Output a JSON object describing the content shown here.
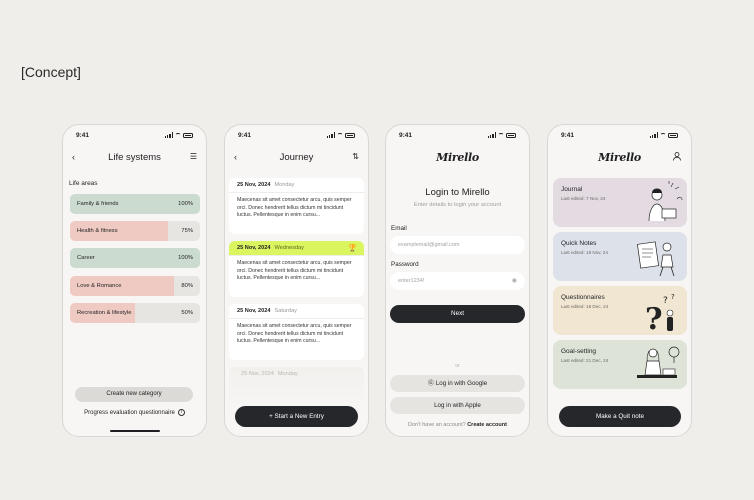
{
  "page_label": "[Concept]",
  "status_time": "9:41",
  "colors": {
    "green": "#ccdbcf",
    "pink": "#efcac2",
    "lime": "#d9f560",
    "lavender": "#e3dae2",
    "blue": "#dde1ea",
    "beige": "#f0e6d2",
    "sage": "#dde3d6"
  },
  "life": {
    "title": "Life systems",
    "back_icon": "chevron-left-icon",
    "filter_icon": "sliders-icon",
    "areas_label": "Life areas",
    "areas": [
      {
        "name": "Family & friends",
        "percent": "100%",
        "value": 100,
        "color": "#ccdbcf"
      },
      {
        "name": "Health & fitness",
        "percent": "75%",
        "value": 75,
        "color": "#efcac2"
      },
      {
        "name": "Career",
        "percent": "100%",
        "value": 100,
        "color": "#ccdbcf"
      },
      {
        "name": "Love & Romance",
        "percent": "80%",
        "value": 80,
        "color": "#efcac2"
      },
      {
        "name": "Recreation & lifestyle",
        "percent": "50%",
        "value": 50,
        "color": "#efcac2"
      }
    ],
    "create_btn": "Create new category",
    "questionnaire_link": "Progress evaluation questionnaire"
  },
  "journey": {
    "title": "Journey",
    "entries": [
      {
        "date": "25 Nov, 2024",
        "day": "Monday",
        "text": "Maecenas sit amet consectetur arcu, quis semper orci. Donec hendrerit tellus dictum mi tincidunt luctus. Pellentesque in enim cursu..."
      },
      {
        "date": "25 Nov, 2024",
        "day": "Wednesday",
        "text": "Maecenas sit amet consectetur arcu, quis semper orci. Donec hendrerit tellus dictum mi tincidunt luctus. Pellentesque in enim cursu..."
      },
      {
        "date": "25 Nov, 2024",
        "day": "Saturday",
        "text": "Maecenas sit amet consectetur arcu, quis semper orci. Donec hendrerit tellus dictum mi tincidunt luctus. Pellentesque in enim cursu..."
      }
    ],
    "faded_entry": {
      "date": "25 Nov, 2024",
      "day": "Monday"
    },
    "new_entry_btn": "Start a New Entry"
  },
  "login": {
    "logo": "Mirello",
    "title": "Login to Mirello",
    "subtitle": "Enter details to login your account",
    "email_label": "Email",
    "email_placeholder": "examplemail@gmail.com",
    "password_label": "Password",
    "password_value": "enter1234!",
    "next_btn": "Next",
    "or": "or",
    "google_btn": "Log in with Google",
    "apple_btn": "Log in with Apple",
    "no_account": "Don't have an account?",
    "create_account": "Create account"
  },
  "home": {
    "logo": "Mirello",
    "cards": [
      {
        "title": "Journal",
        "edited": "Last edited: 7 Nov, 24",
        "color": "#e3dae2"
      },
      {
        "title": "Quick Notes",
        "edited": "Last edited: 19 Nov, 24",
        "color": "#dde1ea"
      },
      {
        "title": "Questionnaires",
        "edited": "Last edited: 18 Dec, 24",
        "color": "#f0e6d2"
      },
      {
        "title": "Goal-setting",
        "edited": "Last edited: 21 Dec, 24",
        "color": "#dde3d6"
      }
    ],
    "quit_btn": "Make a Quit note"
  }
}
